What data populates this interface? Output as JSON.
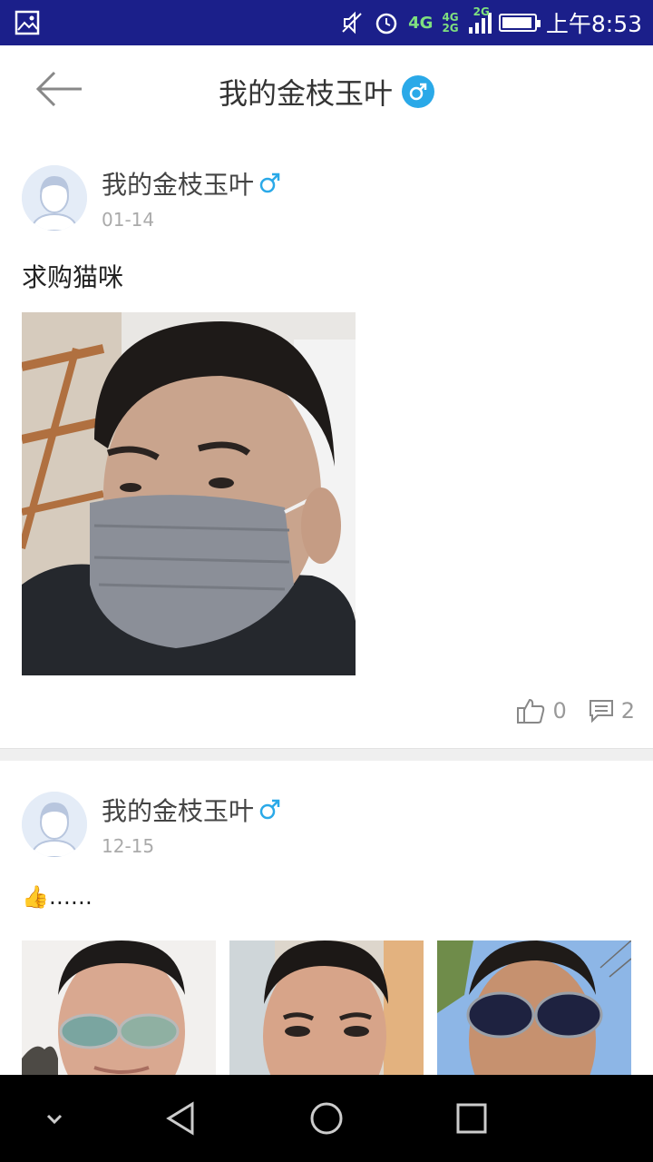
{
  "status_bar": {
    "network_primary": "4G",
    "network_secondary_top": "4G",
    "network_secondary_bottom": "2G",
    "network_tertiary": "2G",
    "time": "上午8:53",
    "battery_level": 0.85,
    "icons": [
      "image-icon",
      "mute-icon",
      "alarm-icon",
      "signal-icon",
      "battery-icon"
    ]
  },
  "header": {
    "title": "我的金枝玉叶",
    "back_icon": "arrow-left-icon",
    "gender_icon": "male-icon"
  },
  "posts": [
    {
      "author": "我的金枝玉叶",
      "date": "01-14",
      "text": "求购猫咪",
      "likes": "0",
      "comments": "2"
    },
    {
      "author": "我的金枝玉叶",
      "date": "12-15",
      "text": "……",
      "emoji": "👍"
    }
  ],
  "colors": {
    "status_bar": "#1b1f8a",
    "accent": "#2aa9e8",
    "divider": "#efefef"
  }
}
